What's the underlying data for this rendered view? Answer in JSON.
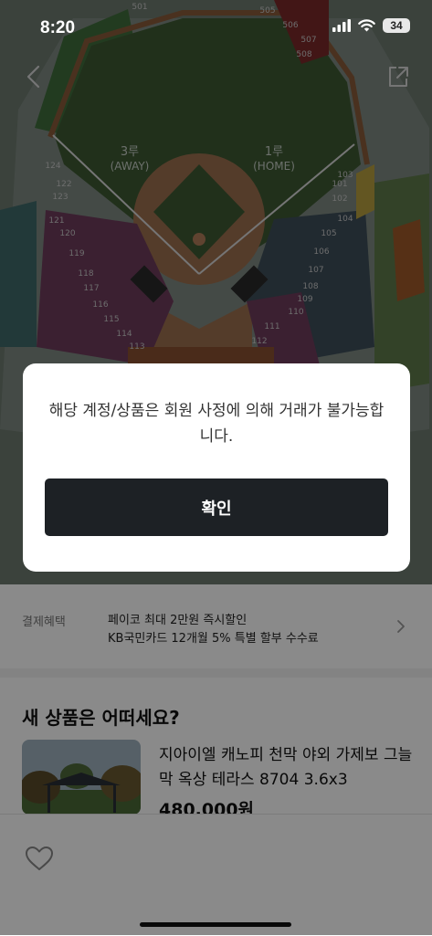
{
  "status_bar": {
    "time": "8:20",
    "battery": "34"
  },
  "stadium": {
    "third_base": "3루",
    "third_base_sub": "(AWAY)",
    "first_base": "1루",
    "first_base_sub": "(HOME)",
    "sections": [
      "501",
      "505",
      "506",
      "507",
      "508",
      "121",
      "120",
      "119",
      "118",
      "117",
      "116",
      "115",
      "114",
      "113",
      "105",
      "106",
      "107",
      "108",
      "109",
      "110",
      "111",
      "112",
      "122",
      "123",
      "124",
      "101",
      "102",
      "103",
      "104"
    ]
  },
  "payment": {
    "label": "결제혜택",
    "line1": "페이코 최대 2만원 즉시할인",
    "line2": "KB국민카드 12개월 5% 특별 할부 수수료"
  },
  "recommend": {
    "title": "새 상품은 어떠세요?",
    "product_name": "지아이엘 캐노피 천막 야외 가제보 그늘막 옥상 테라스 8704 3.6x3",
    "price": "480,000원"
  },
  "dialog": {
    "message": "해당 계정/상품은 회원 사정에 의해 거래가 불가능합니다.",
    "confirm_label": "확인"
  },
  "icons": {
    "back": "back-chevron-icon",
    "share": "share-icon",
    "heart": "heart-icon"
  }
}
